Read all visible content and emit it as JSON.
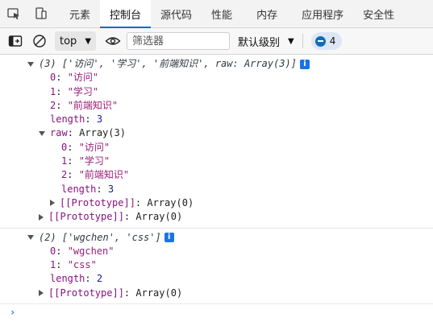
{
  "tabs": [
    {
      "label": "元素"
    },
    {
      "label": "控制台"
    },
    {
      "label": "源代码"
    },
    {
      "label": "性能"
    },
    {
      "label": "内存"
    },
    {
      "label": "应用程序"
    },
    {
      "label": "安全性"
    }
  ],
  "toolbar": {
    "context": "top",
    "filter_placeholder": "筛选器",
    "levels_label": "默认级别",
    "issues_count": "4"
  },
  "log1": {
    "summary": "(3) ['访问', '学习', '前端知识', raw: Array(3)]",
    "items": [
      {
        "key": "0",
        "value": "\"访问\""
      },
      {
        "key": "1",
        "value": "\"学习\""
      },
      {
        "key": "2",
        "value": "\"前端知识\""
      }
    ],
    "length_key": "length",
    "length_value": "3",
    "raw_key": "raw",
    "raw_value": "Array(3)",
    "raw_items": [
      {
        "key": "0",
        "value": "\"访问\""
      },
      {
        "key": "1",
        "value": "\"学习\""
      },
      {
        "key": "2",
        "value": "\"前端知识\""
      }
    ],
    "raw_length_value": "3",
    "proto_key": "[[Prototype]]",
    "proto_value": "Array(0)"
  },
  "log2": {
    "summary": "(2) ['wgchen', 'css']",
    "items": [
      {
        "key": "0",
        "value": "\"wgchen\""
      },
      {
        "key": "1",
        "value": "\"css\""
      }
    ],
    "length_key": "length",
    "length_value": "2",
    "proto_key": "[[Prototype]]",
    "proto_value": "Array(0)"
  },
  "prompt": "›"
}
